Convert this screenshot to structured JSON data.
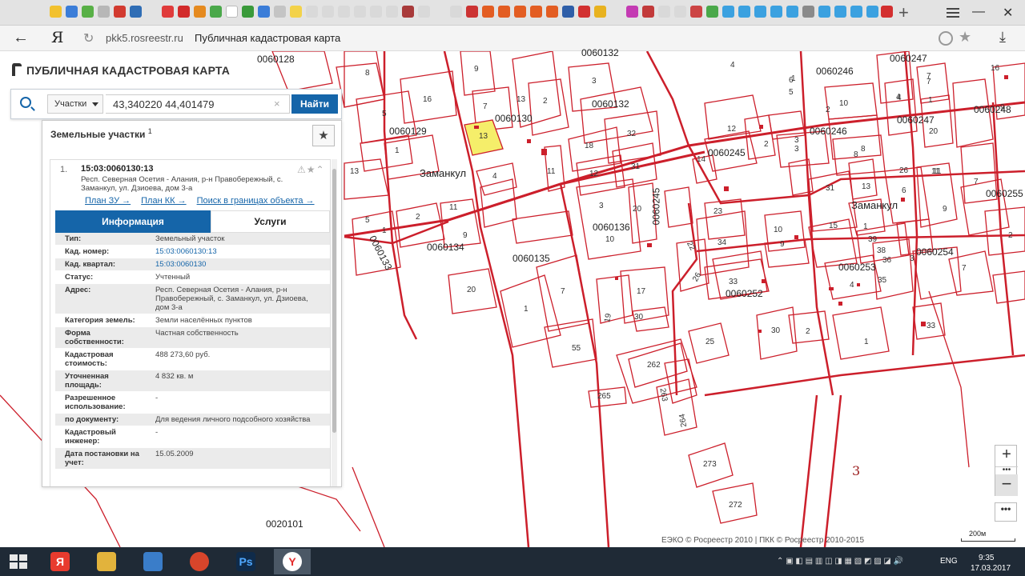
{
  "browser": {
    "url_host": "pkk5.rosreestr.ru",
    "page_title": "Публичная кадастровая карта",
    "yandex_letter": "Я"
  },
  "app": {
    "logo_text": "ПУБЛИЧНАЯ КАДАСТРОВАЯ КАРТА"
  },
  "search": {
    "type_label": "Участки",
    "query": "43,340220 44,401479",
    "clear_glyph": "×",
    "button_label": "Найти"
  },
  "results": {
    "title": "Земельные участки",
    "count": "1",
    "fav_glyph": "★",
    "item": {
      "index": "1.",
      "cad_number": "15:03:0060130:13",
      "address": "Респ. Северная Осетия - Алания, р-н Правобережный, с. Заманкул, ул. Дзиоева, дом 3-а",
      "icons": "⚠★⌃",
      "links": [
        "План ЗУ →",
        "План КК →",
        "Поиск в границах объекта →"
      ],
      "tabs": {
        "info": "Информация",
        "services": "Услуги"
      },
      "attributes": [
        {
          "k": "Тип:",
          "v": "Земельный участок"
        },
        {
          "k": "Кад. номер:",
          "v": "15:03:0060130:13"
        },
        {
          "k": "Кад. квартал:",
          "v": "15:03:0060130"
        },
        {
          "k": "Статус:",
          "v": "Учтенный"
        },
        {
          "k": "Адрес:",
          "v": "Респ. Северная Осетия - Алания, р-н Правобережный, с. Заманкул, ул. Дзиоева, дом 3-а"
        },
        {
          "k": "Категория земель:",
          "v": "Земли населённых пунктов"
        },
        {
          "k": "Форма собственности:",
          "v": "Частная собственность"
        },
        {
          "k": "Кадастровая стоимость:",
          "v": "488 273,60 руб."
        },
        {
          "k": "Уточненная площадь:",
          "v": "4 832 кв. м"
        },
        {
          "k": "Разрешенное использование:",
          "v": "-"
        },
        {
          "k": "по документу:",
          "v": "Для ведения личного подсобного хозяйства"
        },
        {
          "k": "Кадастровый инженер:",
          "v": "-"
        },
        {
          "k": "Дата постановки на учет:",
          "v": "15.05.2009"
        }
      ]
    }
  },
  "map": {
    "quarters": [
      "0060128",
      "0060132",
      "0060247",
      "0060246",
      "0060248",
      "0060129",
      "0060130",
      "0060132",
      "0060247",
      "0060245",
      "0060246",
      "0060255",
      "0060136",
      "0060134",
      "0060135",
      "0060254",
      "0060253",
      "0060252",
      "0060133",
      "0060245",
      "0020101"
    ],
    "village": "Заманкул",
    "village2": "Заманкул",
    "selected_parcel": "13",
    "parcel_numbers": [
      "8",
      "9",
      "5",
      "16",
      "7",
      "13",
      "2",
      "1",
      "4",
      "3",
      "18",
      "32",
      "12",
      "31",
      "11",
      "4",
      "20",
      "10",
      "1",
      "3",
      "5",
      "6",
      "10",
      "1",
      "7",
      "4",
      "14",
      "8",
      "2",
      "2",
      "12",
      "23",
      "34",
      "10",
      "9",
      "15",
      "31",
      "13",
      "6",
      "11",
      "1",
      "9",
      "7",
      "39",
      "38",
      "36",
      "35",
      "3",
      "4",
      "17",
      "30",
      "33",
      "22",
      "26",
      "25",
      "30",
      "2",
      "1",
      "33",
      "55",
      "262",
      "263",
      "265",
      "264",
      "273",
      "272",
      "20",
      "1",
      "2",
      "5",
      "11",
      "9",
      "13",
      "19",
      "7",
      "8",
      "16",
      "3",
      "1",
      "26",
      "4",
      "7",
      "20",
      "2",
      "7",
      "11",
      "3",
      "9"
    ],
    "zone_number": "3",
    "attribution": "ЕЭКО © Росреестр 2010 | ПКК © Росреестр 2010-2015",
    "scale": "200м",
    "zoom_in": "+",
    "zoom_out": "−",
    "more": "•••"
  },
  "taskbar": {
    "lang": "ENG",
    "time": "9:35",
    "date": "17.03.2017"
  },
  "colors": {
    "parcel": "#cc1f2b",
    "selected_fill": "#f5ee6a",
    "accent": "#1565a9"
  }
}
